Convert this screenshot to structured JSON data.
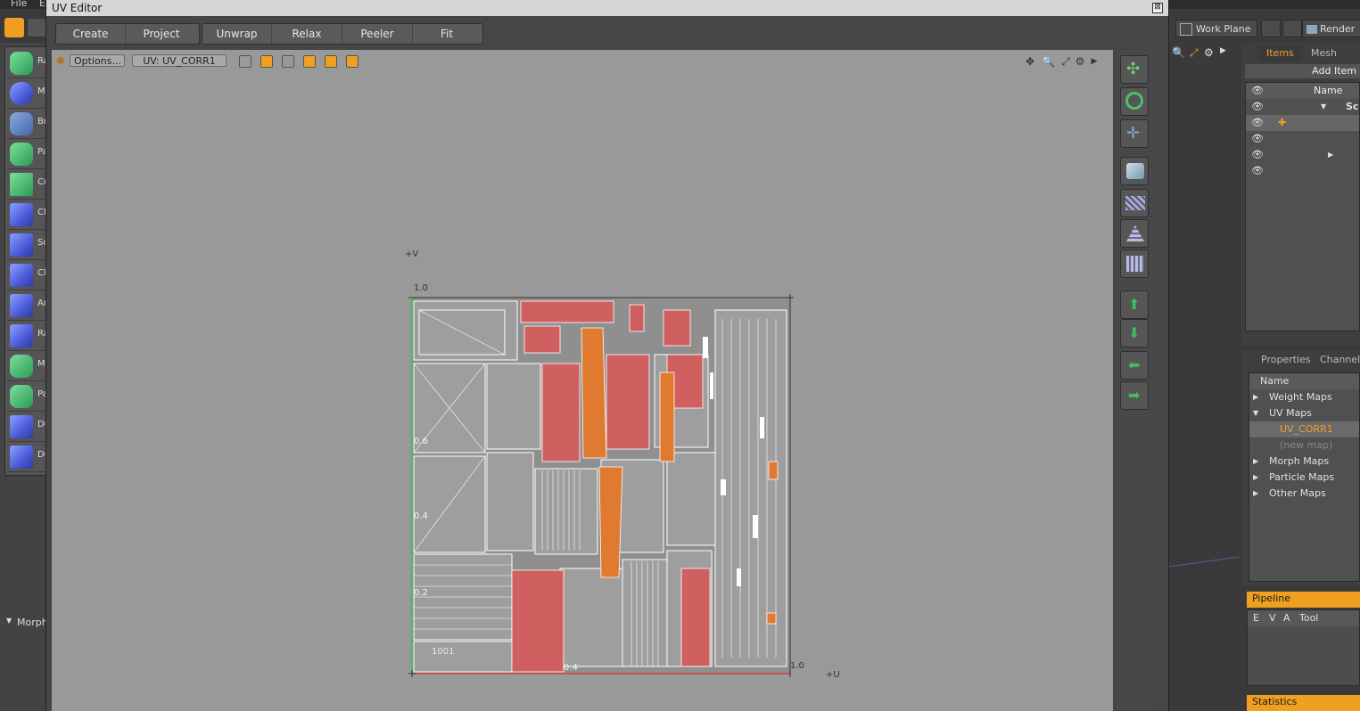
{
  "background_app": {
    "menu": [
      "File",
      "E"
    ],
    "left_tools": [
      {
        "label": "Ra",
        "icon": "radial-sweep-icon"
      },
      {
        "label": "M",
        "icon": "mirror-icon"
      },
      {
        "label": "Br",
        "icon": "bridge-icon"
      },
      {
        "label": "Pa",
        "icon": "path-generator-icon"
      },
      {
        "label": "Cu",
        "icon": "curve-extrude-icon"
      },
      {
        "label": "Cl",
        "icon": "clone-icon"
      },
      {
        "label": "Sc",
        "icon": "scatter-icon"
      },
      {
        "label": "Cl",
        "icon": "clone-cube-icon"
      },
      {
        "label": "Ar",
        "icon": "array-icon"
      },
      {
        "label": "Ra",
        "icon": "radial-array-icon"
      },
      {
        "label": "M",
        "icon": "mesh-paint-icon"
      },
      {
        "label": "Pa",
        "icon": "paint-icon"
      },
      {
        "label": "Du",
        "icon": "duplicate-icon"
      },
      {
        "label": "Du",
        "icon": "duplicate-stack-icon"
      }
    ],
    "morph_label": "Morph",
    "workplane_label": "Work Plane",
    "render_label": "Render",
    "items_panel": {
      "tabs": [
        "Items",
        "Mesh Ops"
      ],
      "add_item": "Add Item",
      "name_header": "Name",
      "rows": [
        "Sc",
        "",
        "",
        "",
        ""
      ]
    },
    "properties_panel": {
      "tabs": [
        "Properties",
        "Channels"
      ],
      "name_header": "Name",
      "tree": [
        {
          "label": "Weight Maps",
          "expanded": false
        },
        {
          "label": "UV Maps",
          "expanded": true
        },
        {
          "label": "UV_CORR1",
          "child": true,
          "selected": true
        },
        {
          "label": "(new map)",
          "child": true,
          "placeholder": true
        },
        {
          "label": "Morph Maps",
          "expanded": false
        },
        {
          "label": "Particle Maps",
          "expanded": false
        },
        {
          "label": "Other Maps",
          "expanded": false
        }
      ]
    },
    "pipeline_panel": {
      "title": "Pipeline",
      "columns": [
        "E",
        "V",
        "A",
        "Tool"
      ]
    },
    "statistics_label": "Statistics"
  },
  "uv_editor": {
    "title": "UV Editor",
    "close": "⊠",
    "toolbar": [
      "Create",
      "Project",
      "Unwrap",
      "Relax",
      "Peeler",
      "Fit"
    ],
    "options_label": "Options...",
    "uv_map_label": "UV: UV_CORR1",
    "axis": {
      "v_label": "+V",
      "u_label": "+U",
      "top_value": "1.0",
      "right_value": "1.0",
      "ticks_v": [
        "0.6",
        "0.4",
        "0.2"
      ],
      "tick_u": "0.4",
      "tile_label": "1001"
    }
  },
  "colors": {
    "accent_orange": "#f0a020",
    "uv_red": "#d06060",
    "uv_orange": "#e07a30",
    "viewport_gray": "#999999"
  }
}
